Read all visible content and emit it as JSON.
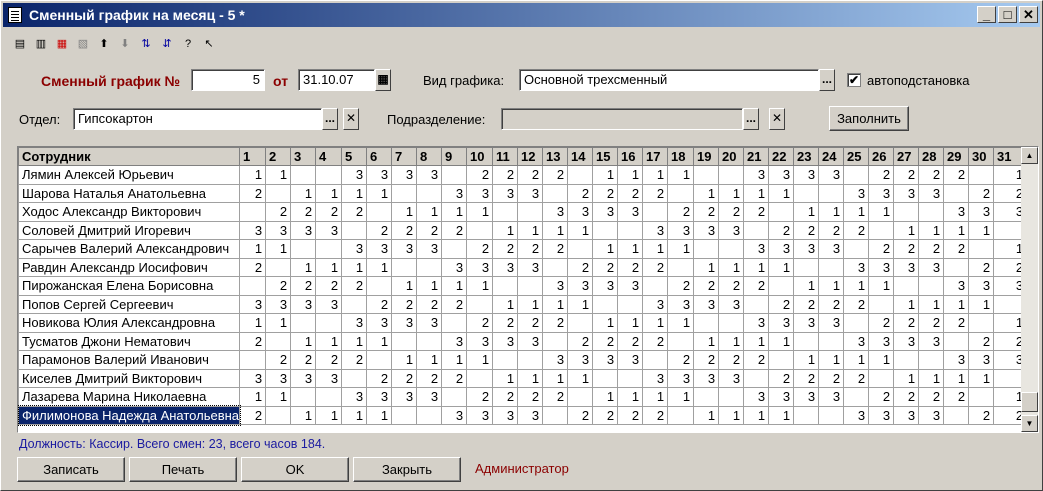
{
  "window": {
    "title": "Сменный график на месяц - 5 *",
    "min": "_",
    "max": "□",
    "close": "✕"
  },
  "form": {
    "schedule_label": "Сменный график №",
    "schedule_number": "5",
    "date_label": "от",
    "date_value": "31.10.07",
    "view_label": "Вид графика:",
    "view_value": "Основной трехсменный",
    "auto_label": "автоподстановка",
    "auto_checked": "✔",
    "dept_label": "Отдел:",
    "dept_value": "Гипсокартон",
    "subdiv_label": "Подразделение:",
    "subdiv_value": "",
    "fill_button": "Заполнить",
    "ellipsis": "...",
    "clear": "✕"
  },
  "grid": {
    "employee_header": "Сотрудник",
    "days": [
      "1",
      "2",
      "3",
      "4",
      "5",
      "6",
      "7",
      "8",
      "9",
      "10",
      "11",
      "12",
      "13",
      "14",
      "15",
      "16",
      "17",
      "18",
      "19",
      "20",
      "21",
      "22",
      "23",
      "24",
      "25",
      "26",
      "27",
      "28",
      "29",
      "30",
      "31"
    ],
    "rows": [
      {
        "name": "Лямин Алексей Юрьевич",
        "d": [
          "1",
          "1",
          "",
          "",
          "3",
          "3",
          "3",
          "3",
          "",
          "2",
          "2",
          "2",
          "2",
          "",
          "1",
          "1",
          "1",
          "1",
          "",
          "",
          "3",
          "3",
          "3",
          "3",
          "",
          "2",
          "2",
          "2",
          "2",
          "",
          "1"
        ]
      },
      {
        "name": "Шарова Наталья Анатольевна",
        "d": [
          "2",
          "",
          "1",
          "1",
          "1",
          "1",
          "",
          "",
          "3",
          "3",
          "3",
          "3",
          "",
          "2",
          "2",
          "2",
          "2",
          "",
          "1",
          "1",
          "1",
          "1",
          "",
          "",
          "3",
          "3",
          "3",
          "3",
          "",
          "2",
          "2"
        ]
      },
      {
        "name": "Ходос Александр Викторович",
        "d": [
          "",
          "2",
          "2",
          "2",
          "2",
          "",
          "1",
          "1",
          "1",
          "1",
          "",
          "",
          "3",
          "3",
          "3",
          "3",
          "",
          "2",
          "2",
          "2",
          "2",
          "",
          "1",
          "1",
          "1",
          "1",
          "",
          "",
          "3",
          "3",
          "3"
        ]
      },
      {
        "name": "Соловей Дмитрий Игоревич",
        "d": [
          "3",
          "3",
          "3",
          "3",
          "",
          "2",
          "2",
          "2",
          "2",
          "",
          "1",
          "1",
          "1",
          "1",
          "",
          "",
          "3",
          "3",
          "3",
          "3",
          "",
          "2",
          "2",
          "2",
          "2",
          "",
          "1",
          "1",
          "1",
          "1",
          ""
        ]
      },
      {
        "name": "Сарычев Валерий Александрович",
        "d": [
          "1",
          "1",
          "",
          "",
          "3",
          "3",
          "3",
          "3",
          "",
          "2",
          "2",
          "2",
          "2",
          "",
          "1",
          "1",
          "1",
          "1",
          "",
          "",
          "3",
          "3",
          "3",
          "3",
          "",
          "2",
          "2",
          "2",
          "2",
          "",
          "1"
        ]
      },
      {
        "name": "Равдин Александр Иосифович",
        "d": [
          "2",
          "",
          "1",
          "1",
          "1",
          "1",
          "",
          "",
          "3",
          "3",
          "3",
          "3",
          "",
          "2",
          "2",
          "2",
          "2",
          "",
          "1",
          "1",
          "1",
          "1",
          "",
          "",
          "3",
          "3",
          "3",
          "3",
          "",
          "2",
          "2"
        ]
      },
      {
        "name": "Пирожанская Елена Борисовна",
        "d": [
          "",
          "2",
          "2",
          "2",
          "2",
          "",
          "1",
          "1",
          "1",
          "1",
          "",
          "",
          "3",
          "3",
          "3",
          "3",
          "",
          "2",
          "2",
          "2",
          "2",
          "",
          "1",
          "1",
          "1",
          "1",
          "",
          "",
          "3",
          "3",
          "3"
        ]
      },
      {
        "name": "Попов Сергей Сергеевич",
        "d": [
          "3",
          "3",
          "3",
          "3",
          "",
          "2",
          "2",
          "2",
          "2",
          "",
          "1",
          "1",
          "1",
          "1",
          "",
          "",
          "3",
          "3",
          "3",
          "3",
          "",
          "2",
          "2",
          "2",
          "2",
          "",
          "1",
          "1",
          "1",
          "1",
          ""
        ]
      },
      {
        "name": "Новикова Юлия Александровна",
        "d": [
          "1",
          "1",
          "",
          "",
          "3",
          "3",
          "3",
          "3",
          "",
          "2",
          "2",
          "2",
          "2",
          "",
          "1",
          "1",
          "1",
          "1",
          "",
          "",
          "3",
          "3",
          "3",
          "3",
          "",
          "2",
          "2",
          "2",
          "2",
          "",
          "1"
        ]
      },
      {
        "name": "Тусматов Джони Нематович",
        "d": [
          "2",
          "",
          "1",
          "1",
          "1",
          "1",
          "",
          "",
          "3",
          "3",
          "3",
          "3",
          "",
          "2",
          "2",
          "2",
          "2",
          "",
          "1",
          "1",
          "1",
          "1",
          "",
          "",
          "3",
          "3",
          "3",
          "3",
          "",
          "2",
          "2"
        ]
      },
      {
        "name": "Парамонов Валерий Иванович",
        "d": [
          "",
          "2",
          "2",
          "2",
          "2",
          "",
          "1",
          "1",
          "1",
          "1",
          "",
          "",
          "3",
          "3",
          "3",
          "3",
          "",
          "2",
          "2",
          "2",
          "2",
          "",
          "1",
          "1",
          "1",
          "1",
          "",
          "",
          "3",
          "3",
          "3"
        ]
      },
      {
        "name": "Киселев Дмитрий Викторович",
        "d": [
          "3",
          "3",
          "3",
          "3",
          "",
          "2",
          "2",
          "2",
          "2",
          "",
          "1",
          "1",
          "1",
          "1",
          "",
          "",
          "3",
          "3",
          "3",
          "3",
          "",
          "2",
          "2",
          "2",
          "2",
          "",
          "1",
          "1",
          "1",
          "1",
          ""
        ]
      },
      {
        "name": "Лазарева Марина Николаевна",
        "d": [
          "1",
          "1",
          "",
          "",
          "3",
          "3",
          "3",
          "3",
          "",
          "2",
          "2",
          "2",
          "2",
          "",
          "1",
          "1",
          "1",
          "1",
          "",
          "",
          "3",
          "3",
          "3",
          "3",
          "",
          "2",
          "2",
          "2",
          "2",
          "",
          "1"
        ]
      },
      {
        "name": "Филимонова Надежда Анатольевна",
        "d": [
          "2",
          "",
          "1",
          "1",
          "1",
          "1",
          "",
          "",
          "3",
          "3",
          "3",
          "3",
          "",
          "2",
          "2",
          "2",
          "2",
          "",
          "1",
          "1",
          "1",
          "1",
          "",
          "",
          "3",
          "3",
          "3",
          "3",
          "",
          "2",
          "2"
        ]
      }
    ]
  },
  "status": {
    "text": "Должность: Кассир. Всего смен: 23, всего часов 184.",
    "user": "Администратор"
  },
  "buttons": {
    "save": "Записать",
    "print": "Печать",
    "ok": "OK",
    "close": "Закрыть"
  },
  "colors": {
    "title_start": "#0a246a",
    "status_text": "#1a1aa0",
    "user_text": "#8b0000",
    "label_red": "#8b0000"
  }
}
